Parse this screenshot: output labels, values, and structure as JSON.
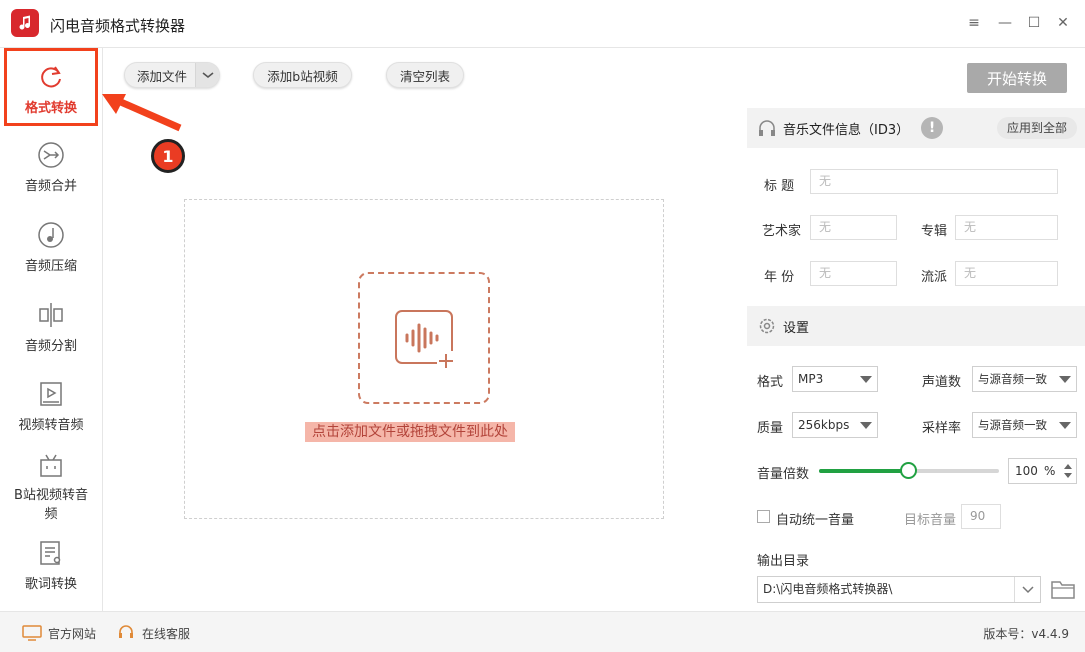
{
  "app": {
    "title": "闪电音频格式转换器",
    "window_controls": [
      "≡",
      "—",
      "☐",
      "✕"
    ]
  },
  "sidebar": {
    "items": [
      {
        "label": "格式转换",
        "icon": "refresh-icon"
      },
      {
        "label": "音频合并",
        "icon": "merge-icon"
      },
      {
        "label": "音频压缩",
        "icon": "compress-icon"
      },
      {
        "label": "音频分割",
        "icon": "split-icon"
      },
      {
        "label": "视频转音频",
        "icon": "video-to-audio-icon"
      },
      {
        "label": "B站视频转音频",
        "icon": "bilibili-icon"
      },
      {
        "label": "歌词转换",
        "icon": "lyrics-icon"
      }
    ],
    "active_index": 0
  },
  "toolbar": {
    "add_file": "添加文件",
    "add_bilibili": "添加b站视频",
    "clear_list": "清空列表",
    "start": "开始转换"
  },
  "dropzone": {
    "hint": "点击添加文件或拖拽文件到此处"
  },
  "id3": {
    "header": "音乐文件信息（ID3）",
    "apply_all": "应用到全部",
    "fields": {
      "title_label": "标 题",
      "artist_label": "艺术家",
      "album_label": "专辑",
      "year_label": "年 份",
      "genre_label": "流派",
      "placeholder": "无"
    }
  },
  "settings": {
    "header": "设置",
    "format_label": "格式",
    "format_value": "MP3",
    "channels_label": "声道数",
    "channels_value": "与源音频一致",
    "quality_label": "质量",
    "quality_value": "256kbps",
    "samplerate_label": "采样率",
    "samplerate_value": "与源音频一致",
    "volume_label": "音量倍数",
    "volume_value": "100",
    "volume_unit": "%",
    "volume_fraction": 0.5,
    "auto_volume_label": "自动统一音量",
    "target_volume_label": "目标音量",
    "target_volume_value": "90",
    "output_label": "输出目录",
    "output_path": "D:\\闪电音频格式转换器\\"
  },
  "statusbar": {
    "website": "官方网站",
    "support": "在线客服",
    "version": "版本号：v4.4.9"
  },
  "annotation": {
    "step": "1"
  },
  "colors": {
    "accent": "#e13b2f",
    "slider": "#21a142",
    "start_button": "#a9a9a9",
    "drop_hint_bg": "#f5b6a9"
  }
}
